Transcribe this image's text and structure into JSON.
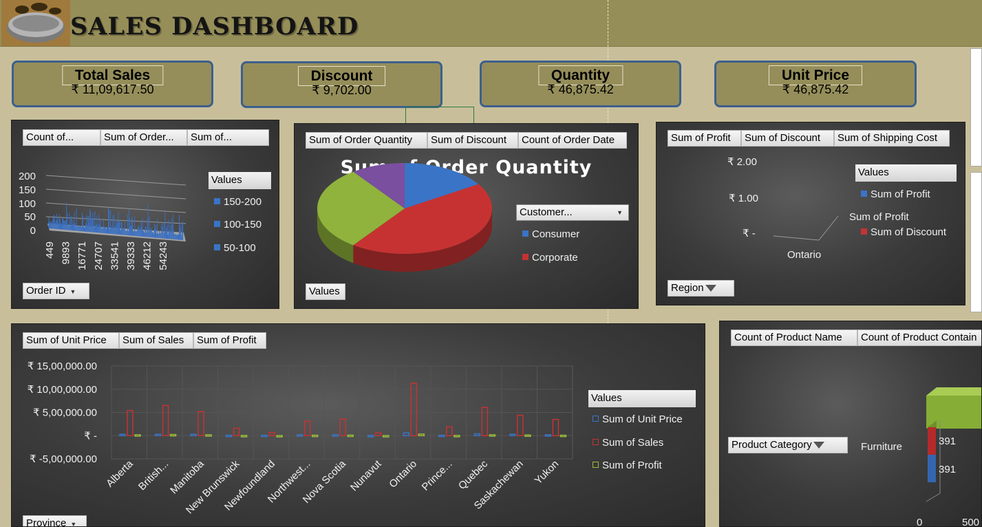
{
  "header": {
    "title": "SALES DASHBOARD"
  },
  "kpis": [
    {
      "label": "Total Sales",
      "value": "₹ 11,09,617.50"
    },
    {
      "label": "Discount",
      "value": "₹ 9,702.00"
    },
    {
      "label": "Quantity",
      "value": "₹ 46,875.42"
    },
    {
      "label": "Unit Price",
      "value": "₹ 46,875.42"
    }
  ],
  "panel1": {
    "buttons": [
      "Count of...",
      "Sum of Order...",
      "Sum of..."
    ],
    "legend_title": "Values",
    "legend": [
      {
        "label": "150-200",
        "color": "#3a74c6"
      },
      {
        "label": "100-150",
        "color": "#3a74c6"
      },
      {
        "label": "50-100",
        "color": "#3a74c6"
      }
    ],
    "y_ticks": [
      "200",
      "150",
      "100",
      "50",
      "0"
    ],
    "x_ticks": [
      "449",
      "9893",
      "16771",
      "24707",
      "33541",
      "39333",
      "46212",
      "54243"
    ],
    "axis_button": "Order ID"
  },
  "panel2": {
    "buttons": [
      "Sum of Order Quantity",
      "Sum of Discount",
      "Count of Order Date"
    ],
    "chart_title": "Sum of Order Quantity",
    "legend_button": "Customer...",
    "legend": [
      {
        "label": "Consumer",
        "color": "#3a74c6"
      },
      {
        "label": "Corporate",
        "color": "#c63232"
      }
    ],
    "values_button": "Values"
  },
  "panel3": {
    "buttons": [
      "Sum of Profit",
      "Sum of Discount",
      "Sum of Shipping Cost"
    ],
    "y_ticks": [
      "₹ 2.00",
      "₹ 1.00",
      "₹ -"
    ],
    "x_label": "Ontario",
    "legend_title": "Values",
    "legend": [
      {
        "label": "Sum of Profit",
        "color": "#3a74c6"
      },
      {
        "label": "Sum of Discount",
        "color": "#c63232"
      }
    ],
    "mid_label": "Sum of Profit",
    "axis_button": "Region"
  },
  "panel4": {
    "buttons": [
      "Sum of Unit Price",
      "Sum of Sales",
      "Sum of Profit"
    ],
    "y_ticks": [
      "₹ 15,00,000.00",
      "₹ 10,00,000.00",
      "₹ 5,00,000.00",
      "₹ -",
      "₹ -5,00,000.00"
    ],
    "legend_title": "Values",
    "legend": [
      {
        "label": "Sum of Unit Price",
        "color": "#3a74c6"
      },
      {
        "label": "Sum of Sales",
        "color": "#c63232"
      },
      {
        "label": "Sum of Profit",
        "color": "#9bbb3c"
      }
    ],
    "axis_button": "Province"
  },
  "panel5": {
    "buttons": [
      "Count of Product Name",
      "Count of Product Contain"
    ],
    "axis_button": "Product Category",
    "category": "Furniture",
    "bar_labels": [
      "391",
      "391"
    ],
    "x_ticks": [
      "0",
      "500"
    ]
  },
  "chart_data": [
    {
      "type": "bar",
      "title": "",
      "x_ticks": [
        "449",
        "9893",
        "16771",
        "24707",
        "33541",
        "39333",
        "46212",
        "54243"
      ],
      "ylim": [
        0,
        200
      ],
      "y_ticks": [
        0,
        50,
        100,
        150,
        200
      ],
      "series": [
        {
          "name": "150-200"
        },
        {
          "name": "100-150"
        },
        {
          "name": "50-100"
        }
      ]
    },
    {
      "type": "pie",
      "title": "Sum of Order Quantity",
      "categories": [
        "Consumer",
        "Corporate",
        "",
        ""
      ],
      "values": [
        16,
        44,
        30,
        10
      ],
      "colors": [
        "#3a74c6",
        "#c63232",
        "#8fb33c",
        "#7a4fa0"
      ]
    },
    {
      "type": "line",
      "categories": [
        "Ontario"
      ],
      "series": [
        {
          "name": "Sum of Profit",
          "values": [
            0
          ]
        },
        {
          "name": "Sum of Discount",
          "values": [
            0
          ]
        }
      ]
    },
    {
      "type": "bar",
      "categories": [
        "Alberta",
        "British...",
        "Manitoba",
        "New Brunswick",
        "Newfoundland",
        "Northwest...",
        "Nova Scotia",
        "Nunavut",
        "Ontario",
        "Prince...",
        "Quebec",
        "Saskachewan",
        "Yukon"
      ],
      "ylim": [
        -500000,
        1500000
      ],
      "series": [
        {
          "name": "Sum of Unit Price",
          "values": [
            30000,
            30000,
            30000,
            10000,
            10000,
            20000,
            20000,
            5000,
            60000,
            10000,
            40000,
            30000,
            20000
          ]
        },
        {
          "name": "Sum of Sales",
          "values": [
            540000,
            650000,
            520000,
            160000,
            70000,
            310000,
            360000,
            60000,
            1130000,
            190000,
            610000,
            440000,
            350000
          ]
        },
        {
          "name": "Sum of Profit",
          "values": [
            20000,
            25000,
            20000,
            5000,
            2000,
            10000,
            12000,
            2000,
            35000,
            5000,
            20000,
            15000,
            10000
          ]
        }
      ]
    },
    {
      "type": "bar",
      "categories": [
        "Furniture"
      ],
      "series": [
        {
          "name": "Count of Product Name",
          "values": [
            391
          ]
        },
        {
          "name": "Count of Product Contain",
          "values": [
            391
          ]
        }
      ]
    }
  ]
}
